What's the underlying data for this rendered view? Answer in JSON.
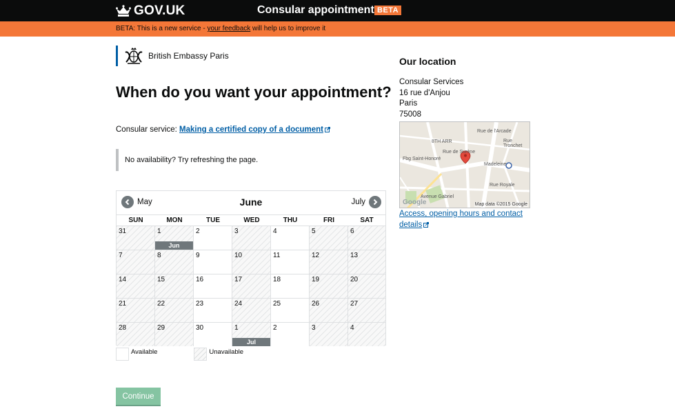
{
  "header": {
    "brand": "GOV.UK",
    "service_name": "Consular appointments",
    "beta_tag": "BETA"
  },
  "banner": {
    "prefix": "BETA: This is a new service - ",
    "link": "your feedback",
    "suffix": " will help us to improve it"
  },
  "organisation": {
    "name": "British Embassy Paris"
  },
  "page_title": "When do you want your appointment?",
  "service": {
    "label": "Consular service: ",
    "link": "Making a certified copy of a document"
  },
  "notice": "No availability? Try refreshing the page.",
  "calendar": {
    "prev_month": "May",
    "current_month": "June",
    "next_month": "July",
    "weekdays": [
      "SUN",
      "MON",
      "TUE",
      "WED",
      "THU",
      "FRI",
      "SAT"
    ],
    "weeks": [
      [
        {
          "d": "31",
          "a": false
        },
        {
          "d": "1",
          "a": false,
          "flag": "Jun"
        },
        {
          "d": "2",
          "a": true
        },
        {
          "d": "3",
          "a": false
        },
        {
          "d": "4",
          "a": true
        },
        {
          "d": "5",
          "a": false
        },
        {
          "d": "6",
          "a": false
        }
      ],
      [
        {
          "d": "7",
          "a": false
        },
        {
          "d": "8",
          "a": false
        },
        {
          "d": "9",
          "a": true
        },
        {
          "d": "10",
          "a": false
        },
        {
          "d": "11",
          "a": true
        },
        {
          "d": "12",
          "a": false
        },
        {
          "d": "13",
          "a": false
        }
      ],
      [
        {
          "d": "14",
          "a": false
        },
        {
          "d": "15",
          "a": false
        },
        {
          "d": "16",
          "a": true
        },
        {
          "d": "17",
          "a": false
        },
        {
          "d": "18",
          "a": true
        },
        {
          "d": "19",
          "a": false
        },
        {
          "d": "20",
          "a": false
        }
      ],
      [
        {
          "d": "21",
          "a": false
        },
        {
          "d": "22",
          "a": false
        },
        {
          "d": "23",
          "a": true
        },
        {
          "d": "24",
          "a": false
        },
        {
          "d": "25",
          "a": true
        },
        {
          "d": "26",
          "a": false
        },
        {
          "d": "27",
          "a": false
        }
      ],
      [
        {
          "d": "28",
          "a": false
        },
        {
          "d": "29",
          "a": false
        },
        {
          "d": "30",
          "a": true
        },
        {
          "d": "1",
          "a": false,
          "flag": "Jul"
        },
        {
          "d": "2",
          "a": true
        },
        {
          "d": "3",
          "a": false
        },
        {
          "d": "4",
          "a": false
        }
      ]
    ]
  },
  "legend": {
    "available": "Available",
    "unavailable": "Unavailable"
  },
  "continue_label": "Continue",
  "sidebar": {
    "title": "Our location",
    "address": [
      "Consular Services",
      "16 rue d'Anjou",
      "Paris",
      "75008"
    ],
    "map": {
      "attribution": "Map data ©2015 Google",
      "google": "Google",
      "labels": [
        "8TH ARR",
        "Madeleine",
        "Rue de Surène",
        "Rue de l'Arcade",
        "Rue Tronchet",
        "Fbg Saint-Honoré",
        "Rue Royale",
        "Avenue Gabriel"
      ]
    },
    "link": "Access, opening hours and contact details"
  },
  "colors": {
    "header_bg": "#0b0c0c",
    "beta_orange": "#f47738",
    "link_blue": "#005ea5",
    "button_green": "#85c4a2",
    "month_flag": "#6f777b"
  }
}
